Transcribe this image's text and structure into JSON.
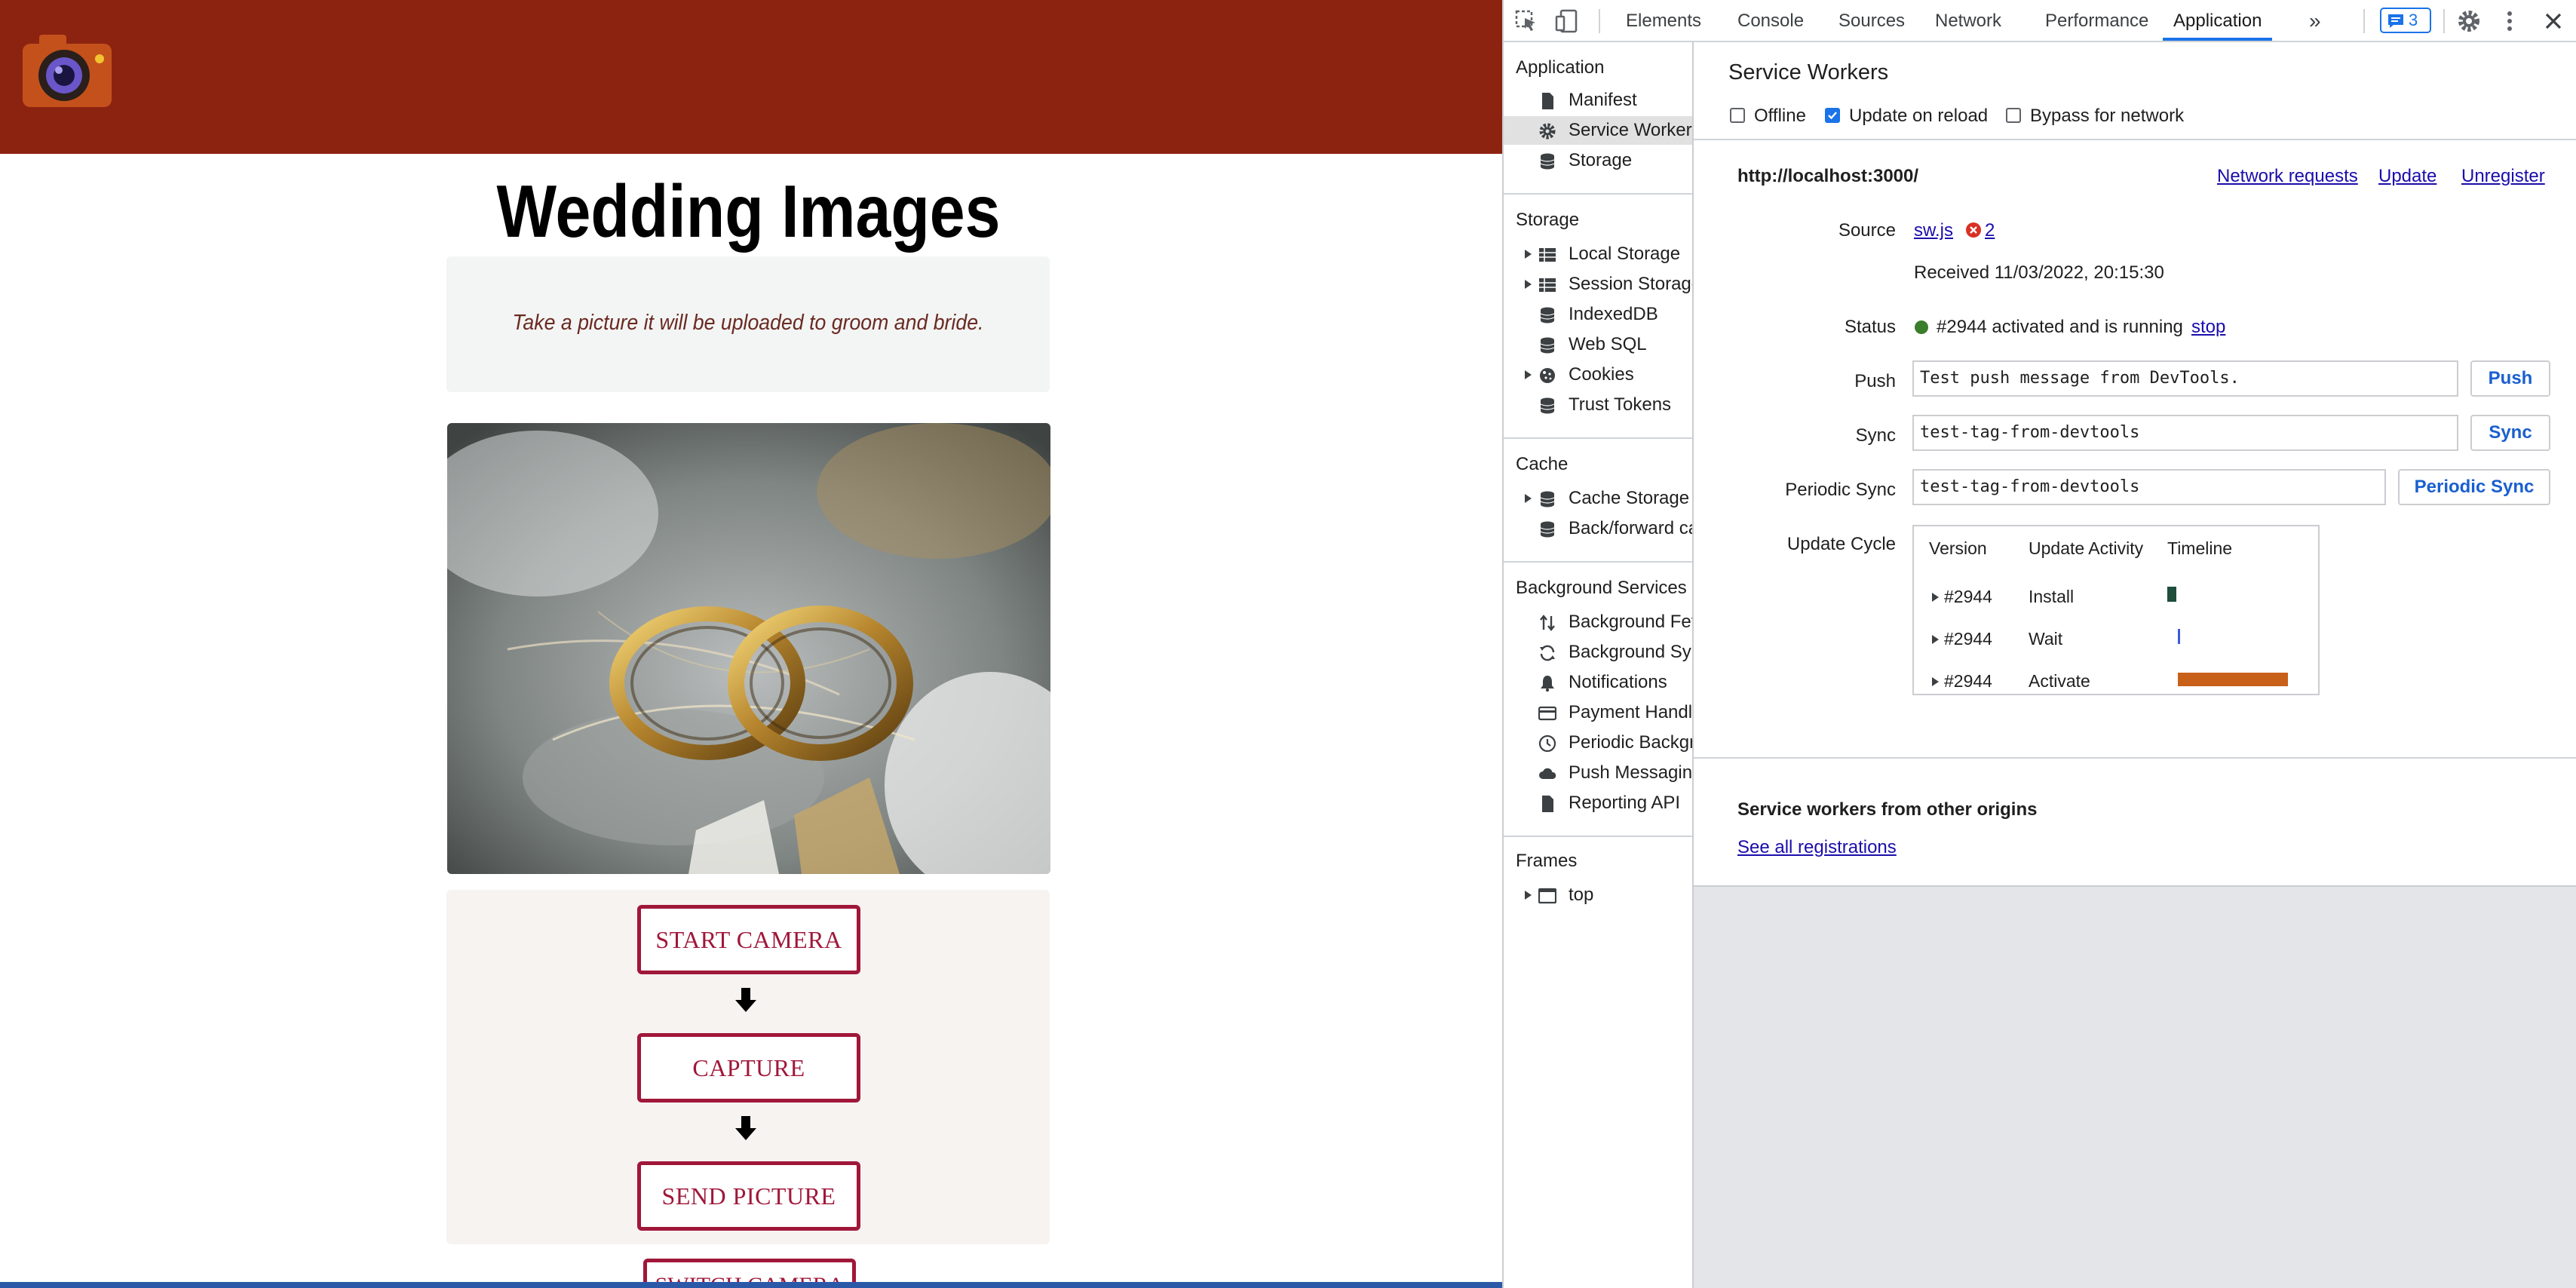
{
  "webpage": {
    "title": "Wedding Images",
    "intro": "Take a picture it will be uploaded to groom and bride.",
    "buttons": {
      "start": "START CAMERA",
      "capture": "CAPTURE",
      "send": "SEND PICTURE",
      "switch": "SWITCH CAMERA"
    }
  },
  "devtools": {
    "tabs": [
      "Elements",
      "Console",
      "Sources",
      "Network",
      "Performance",
      "Application"
    ],
    "active_tab": "Application",
    "more_tabs": "»",
    "issues_count": "3",
    "sidebar": {
      "application_head": "Application",
      "application_items": [
        "Manifest",
        "Service Workers",
        "Storage"
      ],
      "storage_head": "Storage",
      "storage_items": [
        "Local Storage",
        "Session Storage",
        "IndexedDB",
        "Web SQL",
        "Cookies",
        "Trust Tokens"
      ],
      "cache_head": "Cache",
      "cache_items": [
        "Cache Storage",
        "Back/forward cache"
      ],
      "bg_head": "Background Services",
      "bg_items": [
        "Background Fetch",
        "Background Sync",
        "Notifications",
        "Payment Handler",
        "Periodic Background Sync",
        "Push Messaging",
        "Reporting API"
      ],
      "frames_head": "Frames",
      "frames_items": [
        "top"
      ]
    },
    "sw": {
      "title": "Service Workers",
      "offline": "Offline",
      "update_on_reload": "Update on reload",
      "bypass": "Bypass for network",
      "scope": "http://localhost:3000/",
      "network_requests": "Network requests",
      "update": "Update",
      "unregister": "Unregister",
      "source_label": "Source",
      "source_file": "sw.js",
      "error_count": "2",
      "received": "Received 11/03/2022, 20:15:30",
      "status_label": "Status",
      "status_text": "#2944 activated and is running",
      "stop": "stop",
      "push_label": "Push",
      "push_value": "Test push message from DevTools.",
      "push_btn": "Push",
      "sync_label": "Sync",
      "sync_value": "test-tag-from-devtools",
      "sync_btn": "Sync",
      "psync_label": "Periodic Sync",
      "psync_value": "test-tag-from-devtools",
      "psync_btn": "Periodic Sync",
      "cycle_label": "Update Cycle",
      "cycle_headers": [
        "Version",
        "Update Activity",
        "Timeline"
      ],
      "cycle_rows": [
        {
          "version": "#2944",
          "activity": "Install"
        },
        {
          "version": "#2944",
          "activity": "Wait"
        },
        {
          "version": "#2944",
          "activity": "Activate"
        }
      ],
      "other_title": "Service workers from other origins",
      "see_all": "See all registrations"
    },
    "colors": {
      "status_running": "#3a7d2c",
      "install_bar": "#1f4e3d",
      "wait_bar": "#3b5bdb",
      "activate_bar": "#c8601a"
    }
  }
}
